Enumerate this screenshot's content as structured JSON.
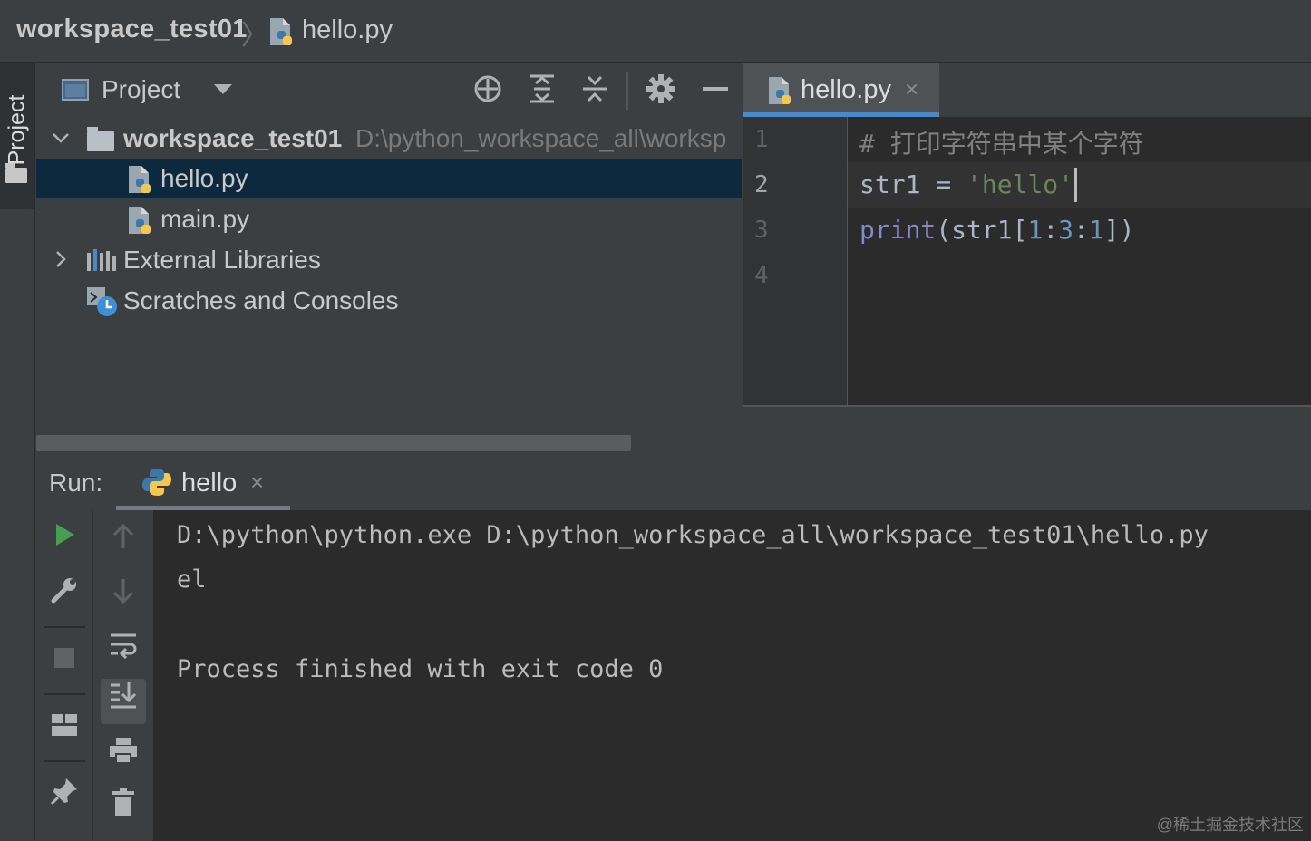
{
  "breadcrumb": {
    "project": "workspace_test01",
    "separator": "〉",
    "file": "hello.py"
  },
  "stripe": {
    "project_tab": "Project"
  },
  "project_panel": {
    "title": "Project",
    "toolbar_icons": [
      "locate-icon",
      "expand-all-icon",
      "collapse-all-icon",
      "gear-icon",
      "minimize-icon"
    ],
    "tree": {
      "root": {
        "name": "workspace_test01",
        "path": "D:\\python_workspace_all\\worksp"
      },
      "files": [
        "hello.py",
        "main.py"
      ],
      "external": "External Libraries",
      "scratches": "Scratches and Consoles"
    }
  },
  "editor": {
    "tab": {
      "label": "hello.py",
      "close": "×"
    },
    "line_numbers": [
      "1",
      "2",
      "3",
      "4"
    ],
    "code": {
      "line1_comment": "# 打印字符串中某个字符",
      "line2_var": "str1 = ",
      "line2_str": "'hello'",
      "line3_func": "print",
      "line3_open": "(str1[",
      "line3_n1": "1",
      "line3_c1": ":",
      "line3_n2": "3",
      "line3_c2": ":",
      "line3_n3": "1",
      "line3_close": "])"
    }
  },
  "run_panel": {
    "label": "Run:",
    "tab": {
      "label": "hello",
      "close": "×"
    },
    "console": {
      "command": "D:\\python\\python.exe D:\\python_workspace_all\\workspace_test01\\hello.py",
      "output": "el",
      "finish": "Process finished with exit code 0"
    }
  },
  "watermark": "@稀土掘金技术社区",
  "colors": {
    "accent": "#4a88c7",
    "run_green": "#499c54",
    "selection": "#0d293e"
  }
}
